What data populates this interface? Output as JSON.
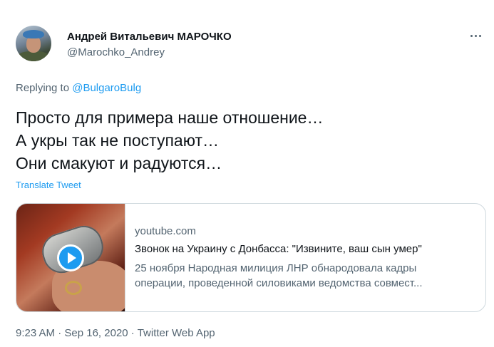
{
  "author": {
    "name": "Андрей Витальевич МАРОЧКО",
    "handle": "@Marochko_Andrey"
  },
  "reply": {
    "prefix": "Replying to ",
    "mention": "@BulgaroBulg"
  },
  "tweet": {
    "lines": [
      "Просто для примера наше отношение…",
      "А укры так не поступают…",
      "Они смакуют и радуются…"
    ],
    "translate_label": "Translate Tweet"
  },
  "card": {
    "domain": "youtube.com",
    "title": "Звонок на Украину с Донбасса: \"Извините, ваш сын умер\"",
    "description_lines": [
      "25 ноября Народная милиция ЛНР обнародовала кадры",
      "операции, проведенной силовиками ведомства совмест..."
    ]
  },
  "meta": {
    "time": "9:23 AM",
    "separator": " · ",
    "date": "Sep 16, 2020",
    "source": "Twitter Web App"
  },
  "colors": {
    "link": "#1d9bf0",
    "secondary_text": "#536471",
    "primary_text": "#0f1419",
    "border": "#cfd9de"
  },
  "icons": {
    "more": "more-horizontal-icon",
    "play": "play-icon"
  }
}
